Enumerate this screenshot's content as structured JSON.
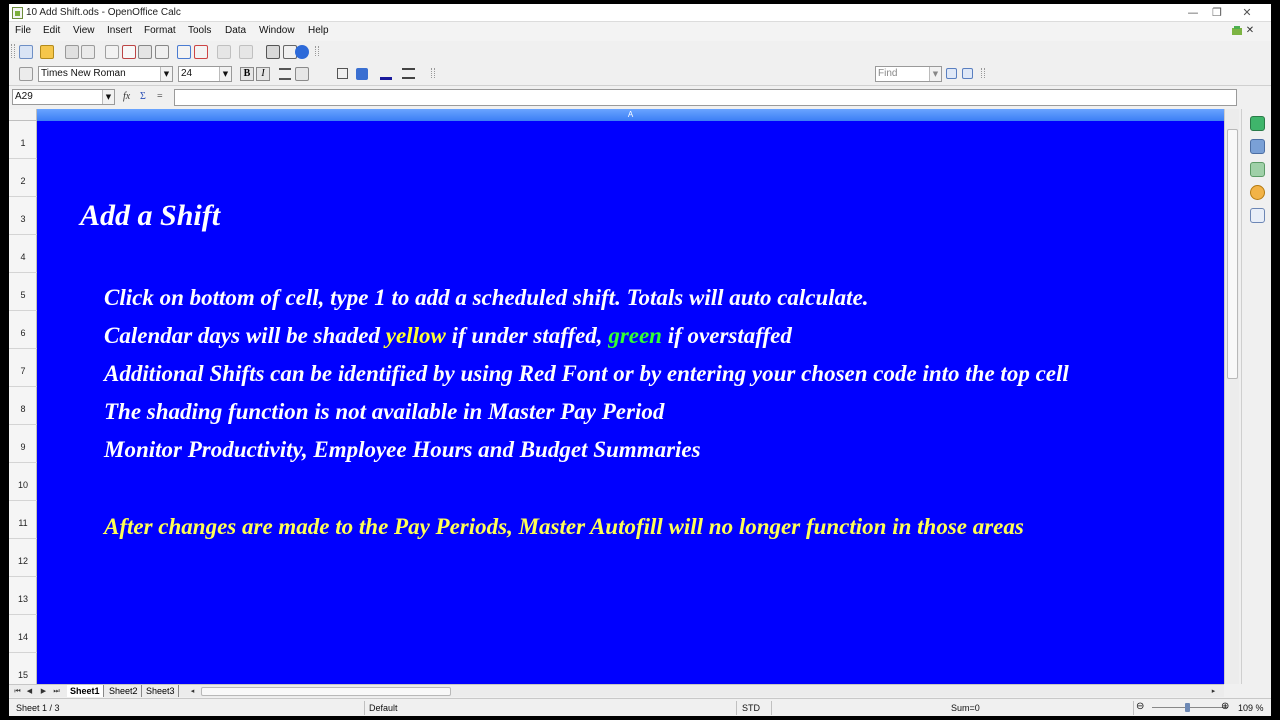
{
  "window": {
    "title": "10 Add Shift.ods - OpenOffice Calc",
    "min_glyph": "—",
    "max_glyph": "❐",
    "close_glyph": "✕"
  },
  "menu": [
    "File",
    "Edit",
    "View",
    "Insert",
    "Format",
    "Tools",
    "Data",
    "Window",
    "Help"
  ],
  "format_toolbar": {
    "font_name": "Times New Roman",
    "font_size": "24",
    "bold_label": "B",
    "italic_label": "I",
    "find_placeholder": "Find"
  },
  "formula_bar": {
    "cell_reference": "A29",
    "fx_label": "fx",
    "sum_label": "Σ",
    "equals_label": "=",
    "formula_value": ""
  },
  "grid": {
    "column_header": "A",
    "row_numbers": [
      "1",
      "2",
      "3",
      "4",
      "5",
      "6",
      "7",
      "8",
      "9",
      "10",
      "11",
      "12",
      "13",
      "14",
      "15"
    ],
    "cell_background": "#0000ff",
    "title": "Add a Shift",
    "line5": "Click on bottom of cell, type 1 to add a scheduled shift. Totals will auto calculate.",
    "line6": {
      "part1": "Calendar days will be shaded ",
      "yellow_word": "yellow",
      "part2": " if under staffed, ",
      "green_word": "green",
      "part3": " if overstaffed"
    },
    "line7": "Additional Shifts can be identified by using Red Font or by entering your chosen code into the top cell",
    "line8": "The shading  function is not available in Master Pay Period",
    "line9": "Monitor Productivity, Employee Hours and Budget Summaries",
    "line11": "After changes are made to the Pay Periods, Master Autofill will no longer function in those areas"
  },
  "sheet_tabs": [
    "Sheet1",
    "Sheet2",
    "Sheet3"
  ],
  "status_bar": {
    "sheet_position": "Sheet 1 / 3",
    "page_style": "Default",
    "selection_mode": "STD",
    "sum": "Sum=0",
    "zoom": "109 %"
  },
  "colors": {
    "accent_blue": "#3b7ef5",
    "highlight_yellow": "#ffff33",
    "highlight_green": "#33ff33"
  }
}
